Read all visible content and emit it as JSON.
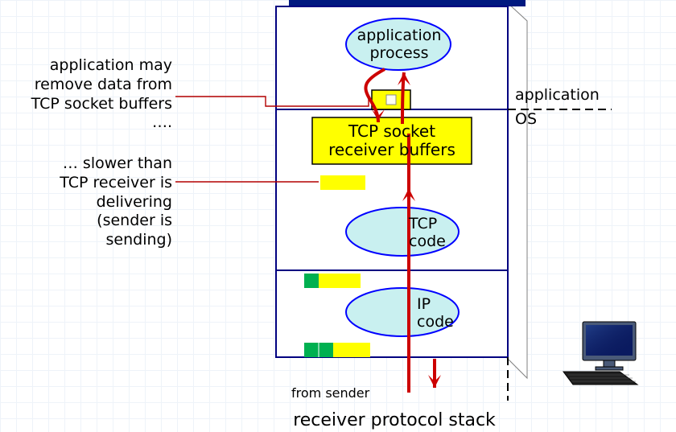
{
  "annotations": {
    "top": "application may remove data from TCP socket buffers ….",
    "mid": "… slower than TCP receiver is delivering (sender is sending)"
  },
  "nodes": {
    "app_process": "application process",
    "tcp_buffers": "TCP socket receiver buffers",
    "tcp_code": "TCP code",
    "ip_code": "IP code"
  },
  "side": {
    "application": "application",
    "os": "OS"
  },
  "from_sender": "from sender",
  "title": "receiver protocol stack",
  "colors": {
    "box_stroke": "#000080",
    "ellipse_fill": "#c9f0f0",
    "ellipse_stroke": "#0000ff",
    "yellow": "#ffff00",
    "green": "#00b050",
    "arrow": "#cc0000",
    "ann_line": "#b30000",
    "topbar": "#001980"
  }
}
